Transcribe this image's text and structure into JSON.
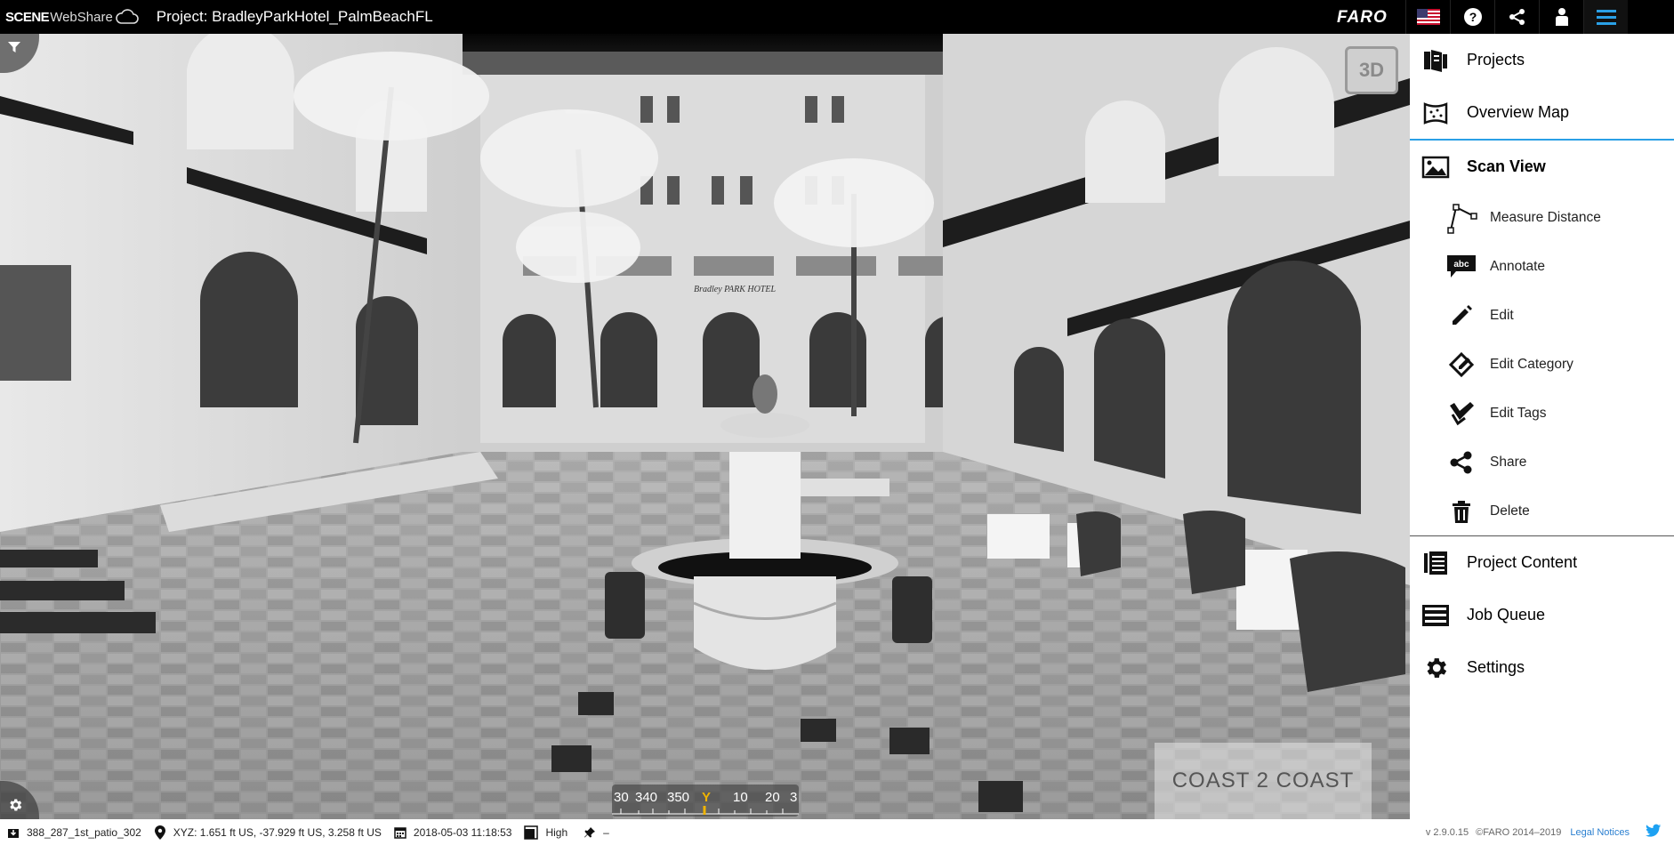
{
  "header": {
    "logo_scene": "SCENE",
    "logo_webshare": "WebShare",
    "project_title": "Project: BradleyParkHotel_PalmBeachFL",
    "brand": "FARO",
    "icons": [
      "us-flag-icon",
      "help-icon",
      "share-icon",
      "user-icon",
      "hamburger-menu-icon"
    ]
  },
  "viewer": {
    "mode_button": "3D",
    "compass_labels": [
      "30",
      "340",
      "350",
      "Y",
      "10",
      "20",
      "3"
    ],
    "watermark": "COAST 2 COAST",
    "hotel_sign": "Bradley PARK HOTEL"
  },
  "menu": {
    "items": [
      {
        "label": "Projects",
        "icon": "projects-icon"
      },
      {
        "label": "Overview Map",
        "icon": "map-icon"
      },
      {
        "label": "Scan View",
        "icon": "scan-view-icon",
        "active": true
      }
    ],
    "sub_items": [
      {
        "label": "Measure Distance",
        "icon": "measure-icon"
      },
      {
        "label": "Annotate",
        "icon": "annotate-icon"
      },
      {
        "label": "Edit",
        "icon": "pencil-icon"
      },
      {
        "label": "Edit Category",
        "icon": "edit-category-icon"
      },
      {
        "label": "Edit Tags",
        "icon": "edit-tags-icon"
      },
      {
        "label": "Share",
        "icon": "share-icon"
      },
      {
        "label": "Delete",
        "icon": "trash-icon"
      }
    ],
    "bottom_items": [
      {
        "label": "Project Content",
        "icon": "project-content-icon"
      },
      {
        "label": "Job Queue",
        "icon": "job-queue-icon"
      },
      {
        "label": "Settings",
        "icon": "gear-icon"
      }
    ]
  },
  "status": {
    "scan_name": "388_287_1st_patio_302",
    "xyz": "XYZ: 1.651 ft US, -37.929 ft US, 3.258 ft US",
    "datetime": "2018-05-03 11:18:53",
    "quality": "High",
    "pin": "–",
    "version": "v 2.9.0.15",
    "copyright": "©FARO 2014–2019",
    "legal": "Legal Notices"
  },
  "colors": {
    "accent": "#2aa0e6",
    "topbar": "#000000",
    "panel": "#ffffff"
  }
}
